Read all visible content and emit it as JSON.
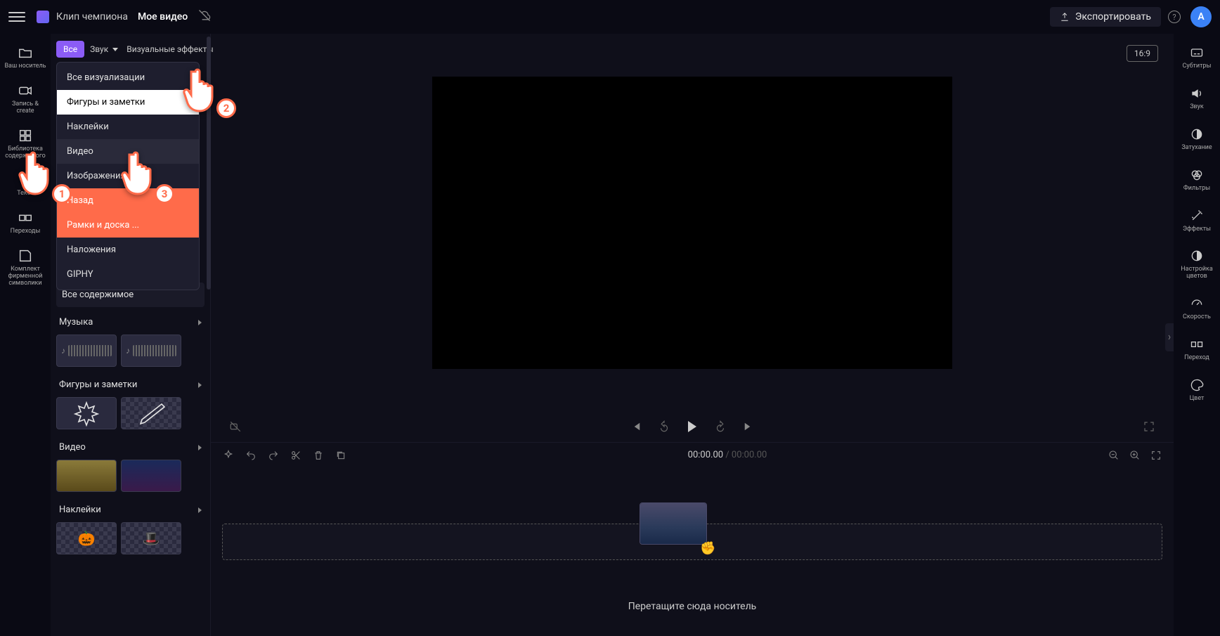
{
  "header": {
    "project": "Клип чемпиона",
    "video_name": "Мое видео",
    "export": "Экспортировать",
    "avatar_initial": "A"
  },
  "left_rail": [
    {
      "label": "Ваш носитель"
    },
    {
      "label": "Запись &\ncreate"
    },
    {
      "label": "Библиотека\nсодержимого"
    },
    {
      "label": "Текст"
    },
    {
      "label": "Переходы"
    },
    {
      "label": "Комплект фирменной символики"
    }
  ],
  "filters": {
    "all": "Все",
    "sound": "Звук",
    "visual": "Визуальные эффекты"
  },
  "dropdown": [
    "Все визуализации",
    "Фигуры и заметки",
    "Наклейки",
    "Видео",
    "Изображения",
    "Назад",
    "Рамки и доска ...",
    "Наложения",
    "GIPHY"
  ],
  "all_content": "Все содержимое",
  "sections": {
    "music": "Музыка",
    "shapes": "Фигуры и заметки",
    "video": "Видео",
    "stickers": "Наклейки"
  },
  "aspect": "16:9",
  "timecode": {
    "current": "00:00.00",
    "duration": "00:00.00"
  },
  "timeline": {
    "drop_hint": "Перетащите сюда носитель"
  },
  "right_rail": [
    {
      "label": "Субтитры"
    },
    {
      "label": "Звук"
    },
    {
      "label": "Затухание"
    },
    {
      "label": "Фильтры"
    },
    {
      "label": "Эффекты"
    },
    {
      "label": "Настройка\nцветов"
    },
    {
      "label": "Скорость"
    },
    {
      "label": "Переход"
    },
    {
      "label": "Цвет"
    }
  ],
  "pointers": {
    "1": "1",
    "2": "2",
    "3": "3"
  }
}
